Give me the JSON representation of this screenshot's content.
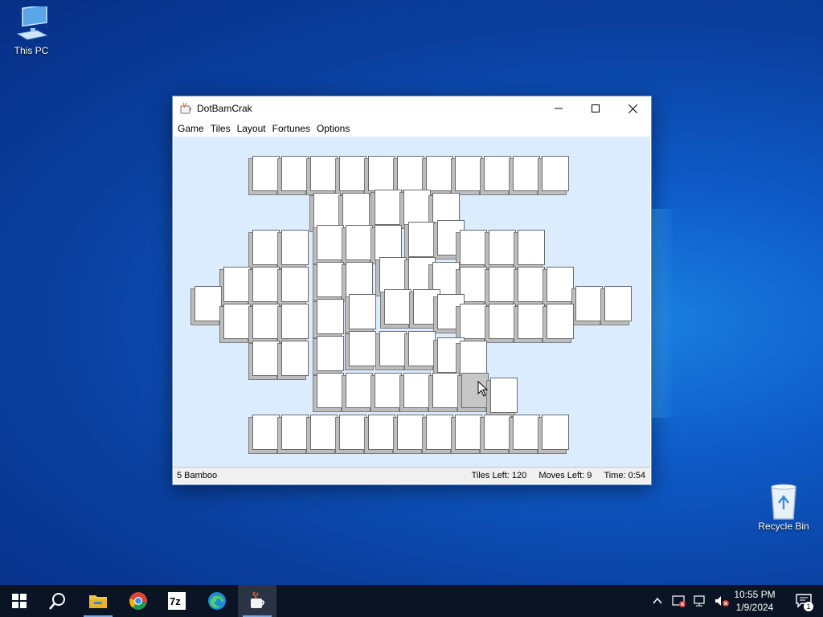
{
  "desktop": {
    "icons": [
      {
        "label": "This PC",
        "icon": "computer-icon"
      },
      {
        "label": "Recycle Bin",
        "icon": "recycle-bin-icon"
      }
    ]
  },
  "window": {
    "title": "DotBamCrak",
    "menu": [
      "Game",
      "Tiles",
      "Layout",
      "Fortunes",
      "Options"
    ],
    "status": {
      "selected_tile": "5 Bamboo",
      "tiles_left": "Tiles Left:  120",
      "moves_left": "Moves Left:  9",
      "time": "Time:  0:54"
    }
  },
  "taskbar": {
    "apps": [
      "start-icon",
      "search-icon",
      "file-explorer-icon",
      "chrome-icon",
      "7zip-icon",
      "edge-icon",
      "java-icon"
    ],
    "clock_time": "10:55 PM",
    "clock_date": "1/9/2024",
    "notification_count": "1"
  },
  "colors": {
    "board": "#dcecff",
    "desktop": "#0a3f9e",
    "taskbar": "#0b1424"
  }
}
